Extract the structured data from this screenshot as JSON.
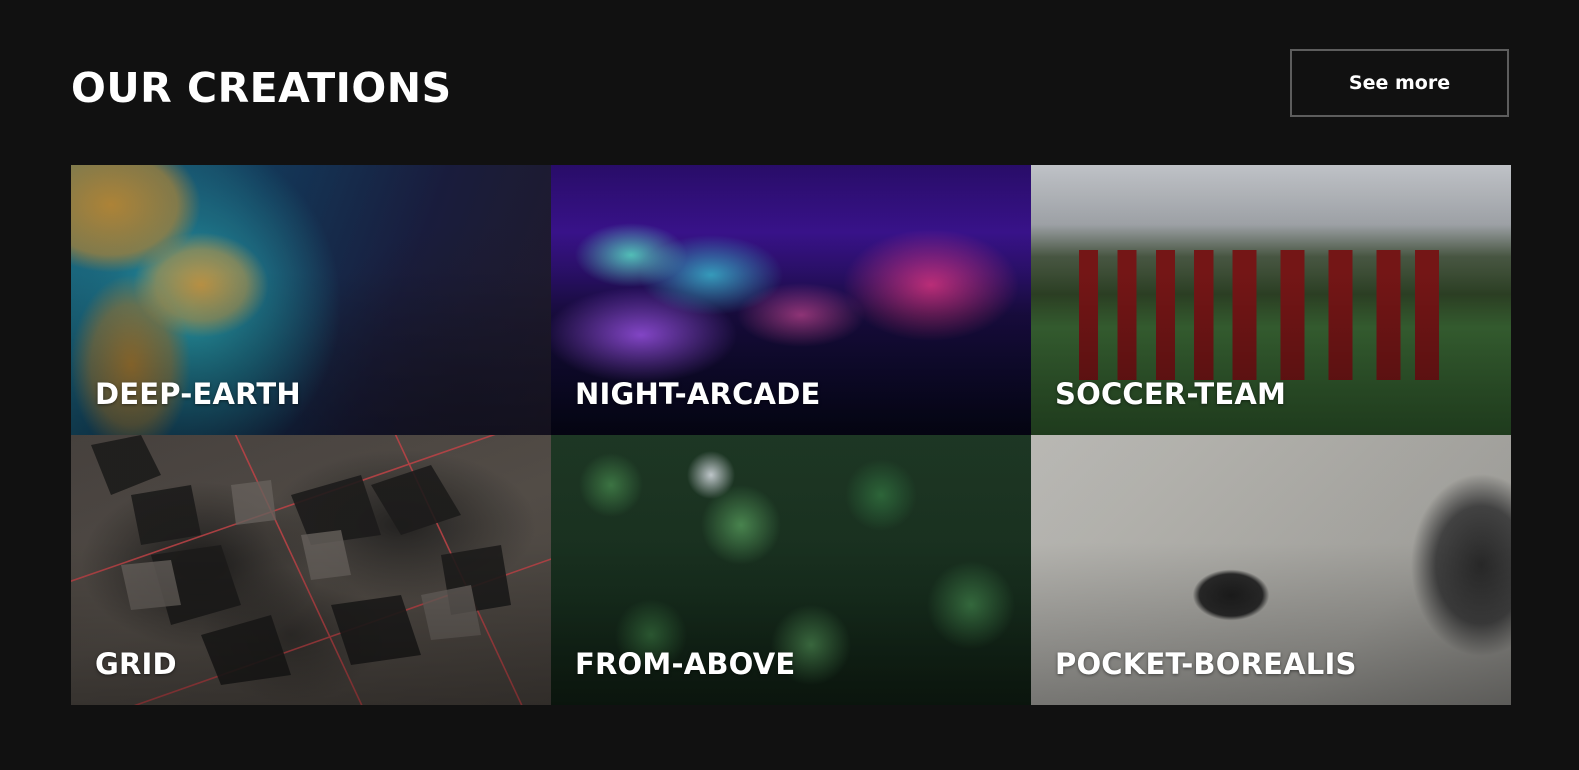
{
  "section": {
    "title": "OUR CREATIONS",
    "see_more_label": "See more"
  },
  "creations": [
    {
      "label": "DEEP-EARTH"
    },
    {
      "label": "NIGHT-ARCADE"
    },
    {
      "label": "SOCCER-TEAM"
    },
    {
      "label": "GRID"
    },
    {
      "label": "FROM-ABOVE"
    },
    {
      "label": "POCKET-BOREALIS"
    }
  ],
  "colors": {
    "background": "#111111",
    "text": "#ffffff",
    "button_border": "#5d5d5d"
  }
}
